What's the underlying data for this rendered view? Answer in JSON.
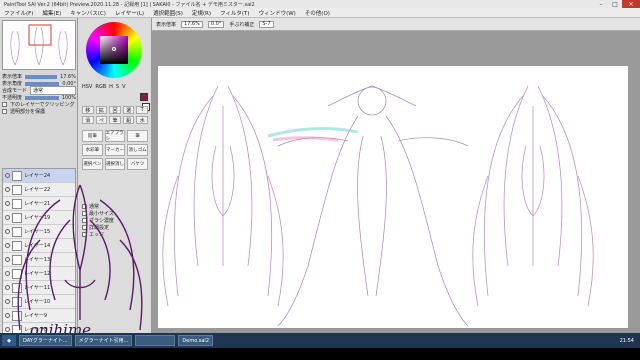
{
  "window": {
    "title": "PaintTool SAI Ver.2 (64bit) Preview.2020.11.28 - 記録用 [1] | SAKAI0 - ファイル名 + デモ用ミスター.sai2"
  },
  "menubar": {
    "items": [
      "ファイル(F)",
      "編集(E)",
      "キャンバス(C)",
      "レイヤー(L)",
      "選択範囲(S)",
      "定規(R)",
      "フィルタ(T)",
      "ウィンドウ(W)",
      "その他(O)"
    ]
  },
  "navigator": {
    "zoom": "17.6%",
    "angle": "0.00°"
  },
  "layer_props": {
    "mode_label": "合成モード",
    "mode_value": "通常",
    "opacity_label": "不透明度",
    "opacity_value": "100%",
    "clip_label": "下のレイヤーでクリッピング",
    "protect_label": "透明部分を保護"
  },
  "layers": [
    {
      "name": "レイヤー24",
      "mode": "100%"
    },
    {
      "name": "レイヤー22",
      "mode": "100%"
    },
    {
      "name": "レイヤー21",
      "mode": "100%"
    },
    {
      "name": "レイヤー19",
      "mode": "100%"
    },
    {
      "name": "レイヤー15",
      "mode": "100%"
    },
    {
      "name": "レイヤー14",
      "mode": "100%"
    },
    {
      "name": "レイヤー13",
      "mode": "100%"
    },
    {
      "name": "レイヤー12",
      "mode": "100%"
    },
    {
      "name": "レイヤー11",
      "mode": "100%"
    },
    {
      "name": "レイヤー10",
      "mode": "100%"
    },
    {
      "name": "レイヤー9",
      "mode": "100%"
    },
    {
      "name": "レイヤー8",
      "mode": "100%"
    }
  ],
  "colors": {
    "foreground": "#8b1a4a",
    "background": "#ffffff",
    "accent": "#6c8cc8"
  },
  "tools": [
    "HSV",
    "RGB",
    "H",
    "S",
    "V"
  ],
  "toolgrid": [
    "移",
    "拡",
    "回",
    "選",
    "T",
    "消",
    "ペ",
    "筆",
    "鉛",
    "水"
  ],
  "brushes": [
    "鉛筆",
    "エアブラシ",
    "筆",
    "水彩筆",
    "マーカー",
    "消しゴム",
    "選択ペン",
    "選択消し",
    "バケツ"
  ],
  "brush_opts": [
    "通常",
    "最小サイズ",
    "ブラシ濃度",
    "詳細設定",
    "エッジ"
  ],
  "canvas_toolbar": {
    "zoom_label": "表示倍率",
    "zoom": "17.6%",
    "angle": "0.0°",
    "stabilizer_label": "手ぶれ補正",
    "stabilizer": "S-7"
  },
  "taskbar": {
    "tasks": [
      "DAYグラーナイト...",
      "メグラーナイト引用...",
      "",
      "Demo.sai2"
    ],
    "clock": "21:54"
  },
  "watermark": "onihime"
}
